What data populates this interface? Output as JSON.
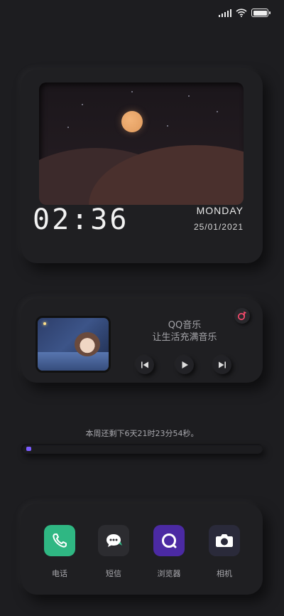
{
  "clock": {
    "time": "02:36",
    "day": "MONDAY",
    "date": "25/01/2021"
  },
  "music": {
    "title": "QQ音乐",
    "subtitle": "让生活充满音乐"
  },
  "countdown": {
    "text": "本周还剩下6天21时23分54秒。",
    "progress": 0.02
  },
  "dock": {
    "apps": [
      {
        "label": "电话",
        "icon": "phone-icon",
        "color": "#2fb783"
      },
      {
        "label": "短信",
        "icon": "message-icon",
        "color": "#2c2c30"
      },
      {
        "label": "浏览器",
        "icon": "browser-icon",
        "color": "#4b2aa3"
      },
      {
        "label": "相机",
        "icon": "camera-icon",
        "color": "#2a2a3a"
      }
    ]
  }
}
